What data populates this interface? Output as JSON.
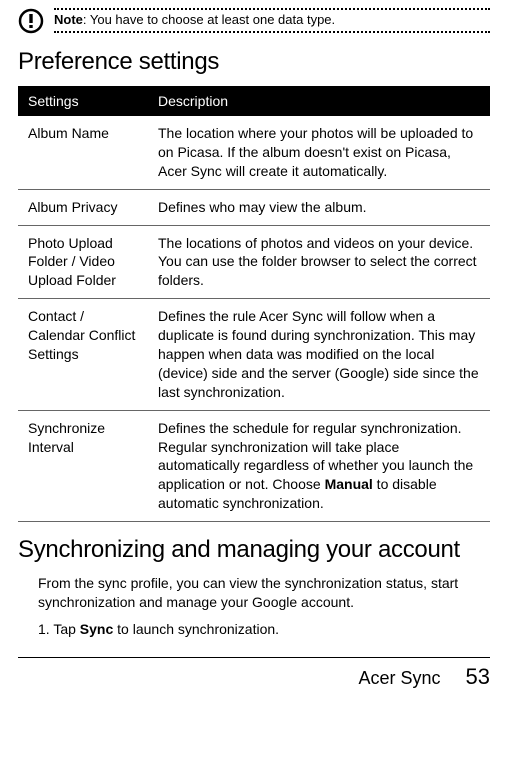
{
  "note": {
    "label": "Note",
    "text": ": You have to choose at least one data type."
  },
  "heading1": "Preference settings",
  "table": {
    "headers": {
      "col1": "Settings",
      "col2": "Description"
    },
    "rows": [
      {
        "name": "Album Name",
        "desc": "The location where your photos will be uploaded to on Picasa. If the album doesn't exist on Picasa, Acer Sync will create it automatically."
      },
      {
        "name": "Album Privacy",
        "desc": "Defines who may view the album."
      },
      {
        "name": "Photo Upload Folder / Video Upload Folder",
        "desc": "The locations of photos and videos on your device. You can use the folder browser to select the correct folders."
      },
      {
        "name": "Contact / Calendar Conflict Settings",
        "desc": "Defines the rule Acer Sync will follow when a duplicate is found during synchronization. This may happen when data was modified on the local (device) side and the server (Google) side since the last synchronization."
      },
      {
        "name": "Synchronize Interval",
        "desc_pre": "Defines the schedule for regular synchronization. Regular synchronization will take place automatically regardless of whether you launch the application or not. Choose ",
        "desc_bold": "Manual",
        "desc_post": " to disable automatic synchronization."
      }
    ]
  },
  "heading2": "Synchronizing and managing your account",
  "intro": "From the sync profile, you can view the synchronization status, start synchronization and manage your Google account.",
  "step1": {
    "num": "1.",
    "pre": "Tap ",
    "bold": "Sync",
    "post": " to launch synchronization."
  },
  "footer": {
    "label": "Acer Sync",
    "page": "53"
  }
}
